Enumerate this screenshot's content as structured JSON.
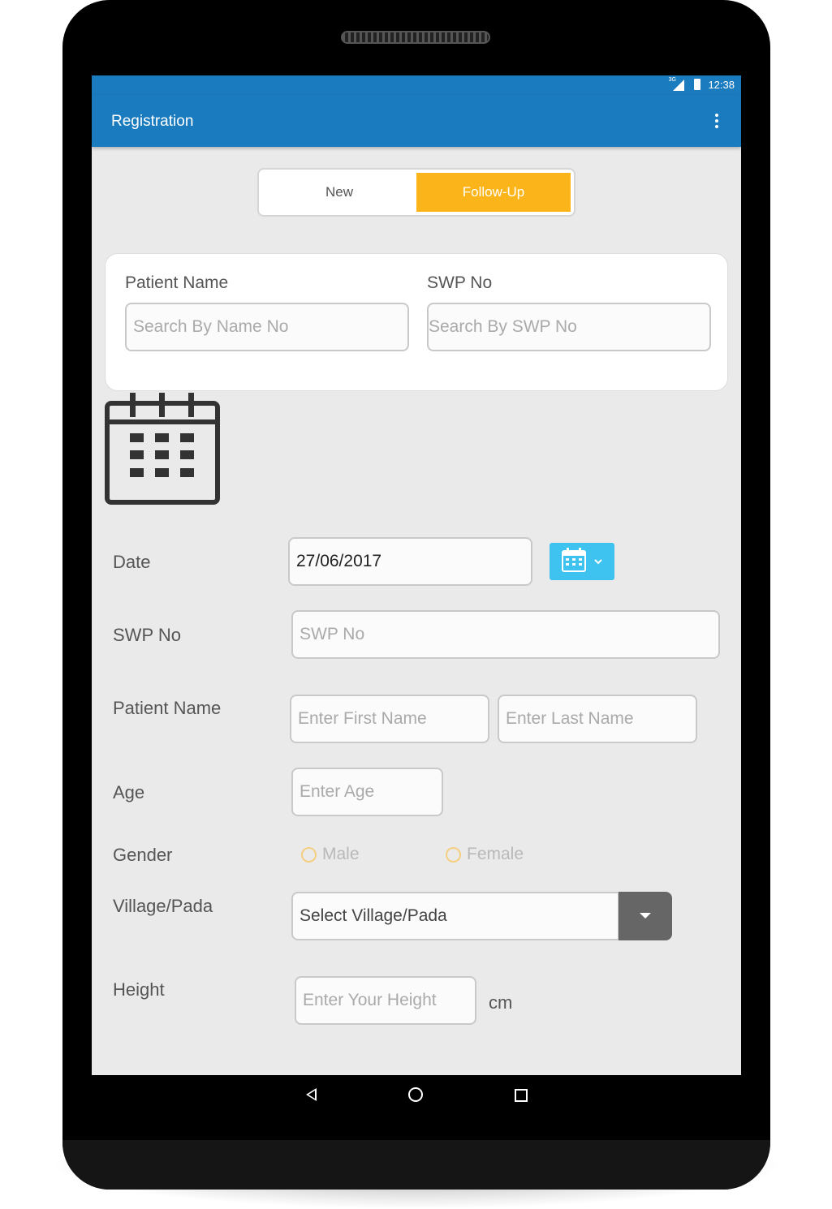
{
  "status_bar": {
    "time": "12:38",
    "network": "3G"
  },
  "app_bar": {
    "title": "Registration",
    "menu_icon": "more-vert-icon"
  },
  "mode_toggle": {
    "options": [
      "New",
      "Follow-Up"
    ],
    "selected": "Follow-Up"
  },
  "search_card": {
    "patient_name_label": "Patient Name",
    "patient_name_placeholder": "Search By Name No",
    "swp_label": "SWP No",
    "swp_placeholder": "Search By SWP No"
  },
  "form": {
    "date_label": "Date",
    "date_value": "27/06/2017",
    "swp_label": "SWP No",
    "swp_placeholder": "SWP No",
    "patient_name_label": "Patient Name",
    "first_name_placeholder": "Enter First Name",
    "last_name_placeholder": "Enter Last Name",
    "age_label": "Age",
    "age_placeholder": "Enter Age",
    "gender_label": "Gender",
    "gender_options": [
      "Male",
      "Female"
    ],
    "village_label": "Village/Pada",
    "village_value": "Select Village/Pada",
    "height_label": "Height",
    "height_placeholder": "Enter Your Height",
    "height_unit": "cm"
  },
  "colors": {
    "primary": "#1a7bbf",
    "accent": "#fbb51a",
    "calendar_button": "#3ec2ef",
    "background": "#eaeaea"
  }
}
